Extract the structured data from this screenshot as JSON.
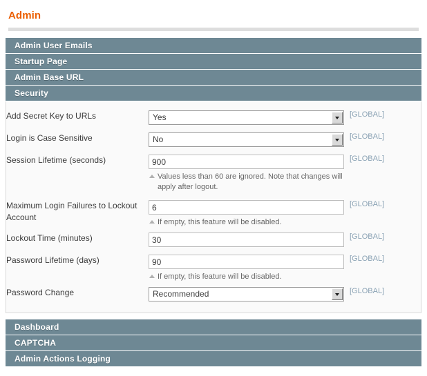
{
  "page": {
    "title": "Admin"
  },
  "sections_top": [
    {
      "label": "Admin User Emails",
      "active": false
    },
    {
      "label": "Startup Page",
      "active": false
    },
    {
      "label": "Admin Base URL",
      "active": false
    },
    {
      "label": "Security",
      "active": true
    }
  ],
  "sections_bottom": [
    {
      "label": "Dashboard",
      "active": false
    },
    {
      "label": "CAPTCHA",
      "active": false
    },
    {
      "label": "Admin Actions Logging",
      "active": false
    }
  ],
  "security_fields": [
    {
      "label": "Add Secret Key to URLs",
      "type": "select",
      "value": "Yes",
      "scope": "[GLOBAL]",
      "note": null,
      "note_line2": null
    },
    {
      "label": "Login is Case Sensitive",
      "type": "select",
      "value": "No",
      "scope": "[GLOBAL]",
      "note": null,
      "note_line2": null
    },
    {
      "label": "Session Lifetime (seconds)",
      "type": "text",
      "value": "900",
      "scope": "[GLOBAL]",
      "note": "Values less than 60 are ignored. Note that changes will",
      "note_line2": "apply after logout."
    },
    {
      "label": "Maximum Login Failures to Lockout Account",
      "type": "text",
      "value": "6",
      "scope": "[GLOBAL]",
      "note": "If empty, this feature will be disabled.",
      "note_line2": null
    },
    {
      "label": "Lockout Time (minutes)",
      "type": "text",
      "value": "30",
      "scope": "[GLOBAL]",
      "note": null,
      "note_line2": null
    },
    {
      "label": "Password Lifetime (days)",
      "type": "text",
      "value": "90",
      "scope": "[GLOBAL]",
      "note": "If empty, this feature will be disabled.",
      "note_line2": null
    },
    {
      "label": "Password Change",
      "type": "select",
      "value": "Recommended",
      "scope": "[GLOBAL]",
      "note": null,
      "note_line2": null
    }
  ],
  "colors": {
    "section_header_bg": "#6e8894",
    "title_accent": "#eb5e00",
    "scope_text": "#8aa2b4",
    "panel_bg": "#fafafa"
  }
}
